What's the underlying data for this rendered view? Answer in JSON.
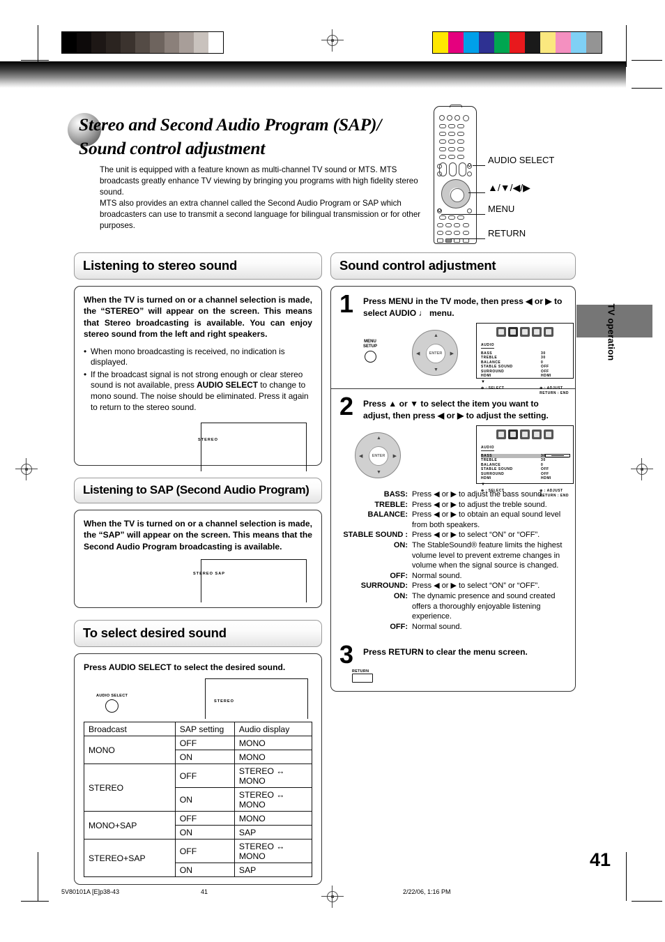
{
  "title": {
    "line1": "Stereo and Second Audio Program (SAP)/",
    "line2": "Sound control adjustment"
  },
  "intro": "The unit is equipped with a feature known as multi-channel TV sound or MTS. MTS broadcasts greatly enhance TV viewing by bringing you programs with high fidelity stereo sound.\nMTS also provides an extra channel called the Second Audio Program or SAP which broadcasters can use to transmit a second language for bilingual transmission or for other purposes.",
  "remote": {
    "callouts": [
      {
        "label": "AUDIO SELECT"
      },
      {
        "label": "▲/▼/◀/▶"
      },
      {
        "label": "MENU"
      },
      {
        "label": "RETURN"
      }
    ]
  },
  "left": {
    "stereo": {
      "heading": "Listening to stereo sound",
      "lead": "When the TV is turned on or a channel selection is made, the “STEREO” will appear on the screen. This means that Stereo broadcasting is available. You can enjoy stereo sound from the left and right speakers.",
      "bullets": [
        "When mono broadcasting is received, no indication is displayed.",
        "If the broadcast signal is not strong enough or clear stereo sound is not available, press AUDIO SELECT to change to mono sound. The noise should be eliminated. Press it again to return to the stereo sound."
      ],
      "screen_text": "STEREO"
    },
    "sap": {
      "heading": "Listening to SAP (Second Audio Program)",
      "lead": "When the TV is turned on or a channel selection is made, the “SAP” will appear on the screen. This means that the Second Audio Program broadcasting is available.",
      "screen_text": "STEREO SAP"
    },
    "select": {
      "heading": "To select desired sound",
      "lead": "Press AUDIO SELECT to select the desired sound.",
      "button_label": "AUDIO SELECT",
      "screen_text": "STEREO"
    },
    "table": {
      "headers": [
        "Broadcast",
        "SAP setting",
        "Audio display"
      ],
      "rows": [
        {
          "broadcast": "MONO",
          "sap": "OFF",
          "display": "MONO",
          "span": 2
        },
        {
          "broadcast": "",
          "sap": "ON",
          "display": "MONO"
        },
        {
          "broadcast": "STEREO",
          "sap": "OFF",
          "display": "STEREO ↔ MONO",
          "span": 2
        },
        {
          "broadcast": "",
          "sap": "ON",
          "display": "STEREO ↔ MONO"
        },
        {
          "broadcast": "MONO+SAP",
          "sap": "OFF",
          "display": "MONO",
          "span": 2
        },
        {
          "broadcast": "",
          "sap": "ON",
          "display": "SAP"
        },
        {
          "broadcast": "STEREO+SAP",
          "sap": "OFF",
          "display": "STEREO ↔ MONO",
          "span": 2
        },
        {
          "broadcast": "",
          "sap": "ON",
          "display": "SAP"
        }
      ]
    }
  },
  "right": {
    "heading": "Sound control adjustment",
    "step1": {
      "num": "1",
      "text": "Press MENU in the TV mode, then press ◀ or ▶ to select AUDIO ♩ menu.",
      "menu_button": "MENU\nSETUP",
      "wheel_label": "ENTER"
    },
    "step2": {
      "num": "2",
      "text": "Press ▲ or ▼ to select the item you want to adjust, then press ◀ or ▶ to adjust the setting.",
      "wheel_label": "ENTER"
    },
    "step3": {
      "num": "3",
      "text": "Press RETURN to clear the menu screen.",
      "button_label": "RETURN"
    },
    "osd": {
      "title": "AUDIO",
      "rows": [
        {
          "key": "BASS",
          "value": "30"
        },
        {
          "key": "TREBLE",
          "value": "30"
        },
        {
          "key": "BALANCE",
          "value": "0"
        },
        {
          "key": "STABLE SOUND",
          "value": "OFF"
        },
        {
          "key": "SURROUND",
          "value": "OFF"
        },
        {
          "key": "HDMI",
          "value": "HDMI"
        }
      ],
      "select_hint": "⊕ : SELECT",
      "adjust_hint": "⊕ : ADJUST",
      "return_hint": "RETURN : END"
    },
    "definitions": [
      {
        "key": "BASS:",
        "value": "Press ◀ or ▶ to adjust the bass sound."
      },
      {
        "key": "TREBLE:",
        "value": "Press ◀ or ▶ to adjust the treble sound."
      },
      {
        "key": "BALANCE:",
        "value": "Press ◀ or ▶ to obtain an equal sound level from both speakers."
      },
      {
        "key": "STABLE SOUND :",
        "value": "Press ◀ or ▶ to select “ON” or “OFF”."
      },
      {
        "key": "ON:",
        "value": "The StableSound® feature limits the highest volume level to prevent extreme changes in volume when the signal source is changed.",
        "indent": true
      },
      {
        "key": "OFF:",
        "value": "Normal sound.",
        "indent": true
      },
      {
        "key": "SURROUND:",
        "value": "Press ◀ or ▶ to select “ON” or “OFF”."
      },
      {
        "key": "ON:",
        "value": "The dynamic presence and sound created offers a thoroughly enjoyable listening experience.",
        "indent": true
      },
      {
        "key": "OFF:",
        "value": "Normal sound.",
        "indent": true
      }
    ]
  },
  "side_tab": {
    "label": "TV operation"
  },
  "page_number": "41",
  "footer": {
    "file": "5V80101A [E]p38-43",
    "page": "41",
    "date": "2/22/06, 1:16 PM"
  },
  "print_marks": {
    "grayscale": [
      "#000000",
      "#0d0a0a",
      "#1d1715",
      "#2b2420",
      "#3b332e",
      "#544b45",
      "#6e645e",
      "#8b807a",
      "#a89e99",
      "#c9c2bd",
      "#ffffff"
    ],
    "colors": [
      "#ffe800",
      "#e5007e",
      "#00a0e9",
      "#2e3192",
      "#00a650",
      "#e8191d",
      "#1a1a1a",
      "#fbe87f",
      "#f490c0",
      "#7fd0f5",
      "#949494"
    ]
  }
}
